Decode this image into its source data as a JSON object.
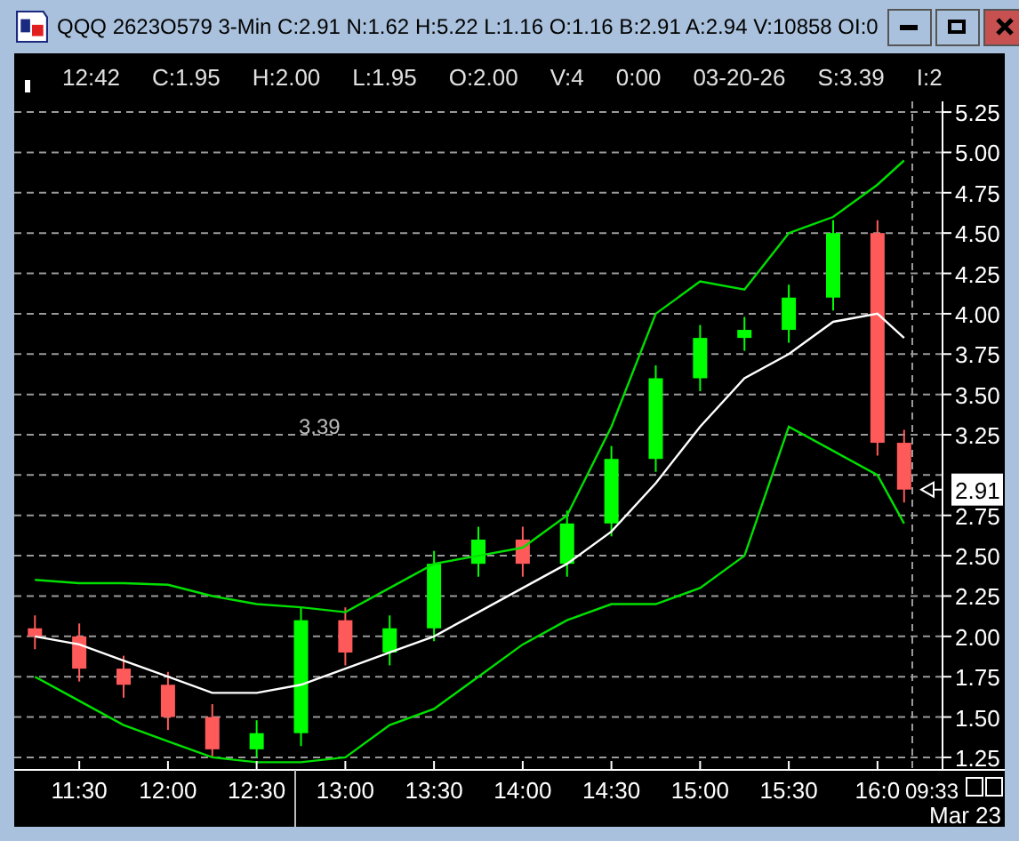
{
  "window": {
    "title": "QQQ 2623O579 3-Min C:2.91 N:1.62 H:5.22 L:1.16 O:1.16 B:2.91 A:2.94 V:10858 OI:0"
  },
  "info_bar": [
    "12:42",
    "C:1.95",
    "H:2.00",
    "L:1.95",
    "O:2.00",
    "V:4",
    "0:00",
    "03-20-26",
    "S:3.39",
    "I:2"
  ],
  "chart": {
    "last_price": "2.91",
    "cursor_time": "09:33",
    "cursor_date": "Mar 23",
    "chart_data": {
      "type": "candlestick",
      "x": [
        675,
        690,
        705,
        720,
        735,
        750,
        765,
        780,
        795,
        810,
        825,
        840,
        855,
        870,
        885,
        900,
        915,
        930,
        945,
        960,
        969
      ],
      "ohlc": [
        [
          2.05,
          2.13,
          1.92,
          2.0
        ],
        [
          2.0,
          2.08,
          1.72,
          1.8
        ],
        [
          1.8,
          1.88,
          1.62,
          1.7
        ],
        [
          1.7,
          1.78,
          1.42,
          1.5
        ],
        [
          1.5,
          1.58,
          1.25,
          1.3
        ],
        [
          1.3,
          1.48,
          1.25,
          1.4
        ],
        [
          1.4,
          2.18,
          1.32,
          2.1
        ],
        [
          2.1,
          2.18,
          1.82,
          1.9
        ],
        [
          1.9,
          2.13,
          1.82,
          2.05
        ],
        [
          2.05,
          2.53,
          1.97,
          2.45
        ],
        [
          2.45,
          2.68,
          2.37,
          2.6
        ],
        [
          2.6,
          2.68,
          2.37,
          2.45
        ],
        [
          2.45,
          2.78,
          2.37,
          2.7
        ],
        [
          2.7,
          3.18,
          2.62,
          3.1
        ],
        [
          3.1,
          3.68,
          3.02,
          3.6
        ],
        [
          3.6,
          3.93,
          3.52,
          3.85
        ],
        [
          3.85,
          3.98,
          3.77,
          3.9
        ],
        [
          3.9,
          4.18,
          3.82,
          4.1
        ],
        [
          4.1,
          4.58,
          4.02,
          4.5
        ],
        [
          4.5,
          4.58,
          3.12,
          3.2
        ],
        [
          3.2,
          3.28,
          2.83,
          2.91
        ]
      ],
      "series": [
        {
          "type": "line",
          "color": "#00e000",
          "values": [
            2.35,
            2.33,
            2.33,
            2.32,
            2.25,
            2.2,
            2.18,
            2.15,
            2.3,
            2.45,
            2.5,
            2.55,
            2.75,
            3.3,
            4.0,
            4.2,
            4.15,
            4.5,
            4.6,
            4.8,
            4.95
          ]
        },
        {
          "type": "line",
          "color": "#ffffff",
          "values": [
            2.0,
            1.95,
            1.85,
            1.75,
            1.65,
            1.65,
            1.7,
            1.8,
            1.9,
            2.0,
            2.15,
            2.3,
            2.45,
            2.65,
            2.95,
            3.3,
            3.6,
            3.75,
            3.95,
            4.0,
            3.85
          ]
        },
        {
          "type": "line",
          "color": "#00e000",
          "values": [
            1.75,
            1.6,
            1.45,
            1.35,
            1.25,
            1.22,
            1.22,
            1.25,
            1.45,
            1.55,
            1.75,
            1.95,
            2.1,
            2.2,
            2.2,
            2.3,
            2.5,
            3.3,
            3.15,
            3.0,
            2.7
          ]
        }
      ],
      "xlim": [
        668,
        982
      ],
      "ylim": [
        1.2,
        5.3
      ],
      "grid": true,
      "yticks": [
        {
          "value": 1.25,
          "label": "1.25"
        },
        {
          "value": 1.5,
          "label": "1.50"
        },
        {
          "value": 1.75,
          "label": "1.75"
        },
        {
          "value": 2.0,
          "label": "2.00"
        },
        {
          "value": 2.25,
          "label": "2.25"
        },
        {
          "value": 2.5,
          "label": "2.50"
        },
        {
          "value": 2.75,
          "label": "2.75"
        },
        {
          "value": 3.25,
          "label": "3.25"
        },
        {
          "value": 3.5,
          "label": "3.50"
        },
        {
          "value": 3.75,
          "label": "3.75"
        },
        {
          "value": 4.0,
          "label": "4.00"
        },
        {
          "value": 4.25,
          "label": "4.25"
        },
        {
          "value": 4.5,
          "label": "4.50"
        },
        {
          "value": 4.75,
          "label": "4.75"
        },
        {
          "value": 5.0,
          "label": "5.00"
        },
        {
          "value": 5.25,
          "label": "5.25"
        }
      ],
      "xticks": [
        {
          "value": 690,
          "label": "11:30"
        },
        {
          "value": 720,
          "label": "12:00"
        },
        {
          "value": 750,
          "label": "12:30"
        },
        {
          "value": 780,
          "label": "13:00"
        },
        {
          "value": 810,
          "label": "13:30"
        },
        {
          "value": 840,
          "label": "14:00"
        },
        {
          "value": 870,
          "label": "14:30"
        },
        {
          "value": 900,
          "label": "15:00"
        },
        {
          "value": 930,
          "label": "15:30"
        },
        {
          "value": 960,
          "label": "16:0"
        }
      ],
      "annotations": [
        "3.39"
      ]
    }
  }
}
